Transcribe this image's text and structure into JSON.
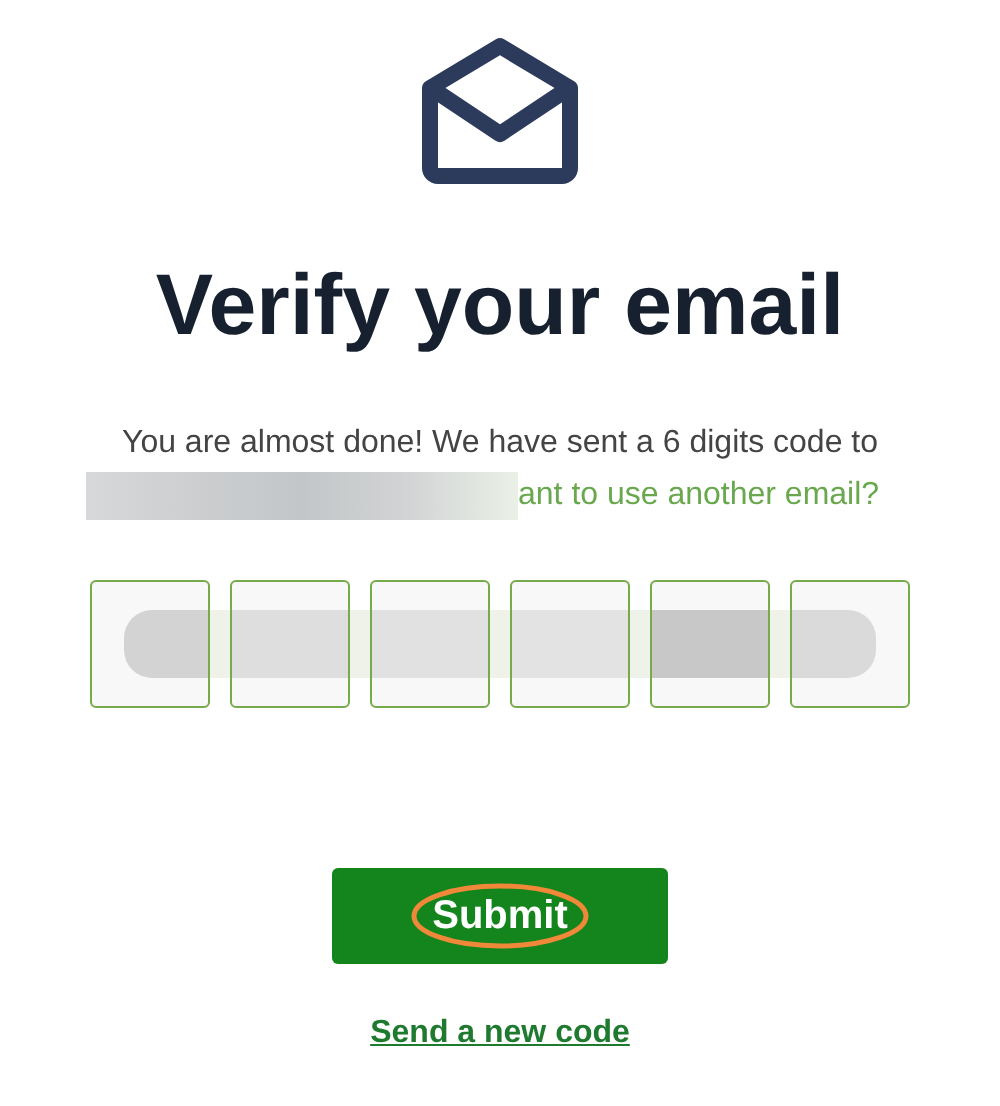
{
  "title": "Verify your email",
  "message": "You are almost done! We have sent a 6 digits code to",
  "change_email_link": "ant to use another email?",
  "code_fields": [
    {
      "kind": "digit"
    },
    {
      "kind": "digit"
    },
    {
      "kind": "digit"
    },
    {
      "kind": "digit"
    },
    {
      "kind": "digit"
    },
    {
      "kind": "digit"
    }
  ],
  "submit_button": "Submit",
  "resend_link": "Send a new code"
}
